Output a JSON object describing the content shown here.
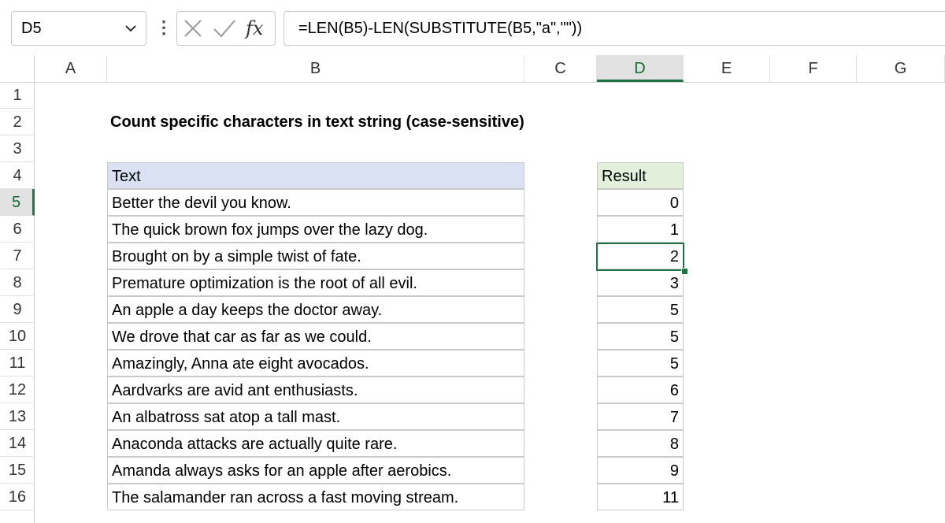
{
  "formula_bar": {
    "name_box": "D5",
    "chevron_icon": "chevron-down-icon",
    "more_icon": "more-vertical-icon",
    "cancel_icon": "cancel-x-icon",
    "enter_icon": "check-icon",
    "fx_label": "fx",
    "formula": "=LEN(B5)-LEN(SUBSTITUTE(B5,\"a\",\"\"))"
  },
  "columns": [
    "A",
    "B",
    "C",
    "D",
    "E",
    "F",
    "G"
  ],
  "active_column": "D",
  "rows": [
    "1",
    "2",
    "3",
    "4",
    "5",
    "6",
    "7",
    "8",
    "9",
    "10",
    "11",
    "12",
    "13",
    "14",
    "15",
    "16"
  ],
  "active_row": "5",
  "sheet": {
    "title": "Count specific characters in text string (case-sensitive)",
    "text_header": "Text",
    "result_header": "Result",
    "data": [
      {
        "text": "Better the devil you know.",
        "result": "0"
      },
      {
        "text": "The quick brown fox jumps over the lazy dog.",
        "result": "1"
      },
      {
        "text": "Brought on by a simple twist of fate.",
        "result": "2"
      },
      {
        "text": "Premature optimization is the root of all evil.",
        "result": "3"
      },
      {
        "text": "An apple a day keeps the doctor away.",
        "result": "5"
      },
      {
        "text": "We drove that car as far as we could.",
        "result": "5"
      },
      {
        "text": "Amazingly, Anna ate eight avocados.",
        "result": "5"
      },
      {
        "text": "Aardvarks are avid ant enthusiasts.",
        "result": "6"
      },
      {
        "text": "An albatross sat atop a tall mast.",
        "result": "7"
      },
      {
        "text": "Anaconda attacks are actually quite rare.",
        "result": "8"
      },
      {
        "text": "Amanda always asks for an apple after aerobics.",
        "result": "9"
      },
      {
        "text": "The salamander ran across a fast moving stream.",
        "result": "11"
      }
    ]
  },
  "colors": {
    "accent_green": "#217346",
    "text_header_fill": "#d9e1f2",
    "result_header_fill": "#e2efda"
  }
}
